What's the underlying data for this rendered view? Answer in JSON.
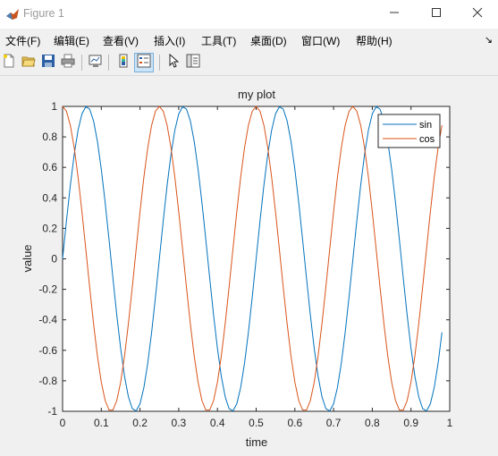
{
  "window": {
    "title": "Figure 1",
    "minimize_icon": "minimize-icon",
    "maximize_icon": "maximize-icon",
    "close_icon": "close-icon"
  },
  "menu": {
    "items": [
      {
        "label": "文件(F)"
      },
      {
        "label": "编辑(E)"
      },
      {
        "label": "查看(V)"
      },
      {
        "label": "插入(I)"
      },
      {
        "label": "工具(T)"
      },
      {
        "label": "桌面(D)"
      },
      {
        "label": "窗口(W)"
      },
      {
        "label": "帮助(H)"
      }
    ],
    "overflow_icon": "dock-arrow-icon"
  },
  "toolbar": {
    "buttons": [
      {
        "icon": "new-figure-icon"
      },
      {
        "icon": "open-file-icon"
      },
      {
        "icon": "save-icon"
      },
      {
        "icon": "print-icon"
      },
      {
        "icon": "link-plot-icon"
      },
      {
        "icon": "insert-colorbar-icon"
      },
      {
        "icon": "insert-legend-icon",
        "active": true
      },
      {
        "icon": "edit-plot-arrow-icon"
      },
      {
        "icon": "property-inspector-icon"
      }
    ]
  },
  "colors": {
    "sin": "#0072bd",
    "cos": "#d95319",
    "axes_bg": "#ffffff",
    "figure_bg": "#f0f0f0"
  },
  "chart_data": {
    "type": "line",
    "title": "my plot",
    "xlabel": "time",
    "ylabel": "value",
    "xlim": [
      0,
      1
    ],
    "ylim": [
      -1,
      1
    ],
    "xticks": [
      "0",
      "0.1",
      "0.2",
      "0.3",
      "0.4",
      "0.5",
      "0.6",
      "0.7",
      "0.8",
      "0.9",
      "1"
    ],
    "yticks": [
      "1",
      "0.8",
      "0.6",
      "0.4",
      "0.2",
      "0",
      "-0.2",
      "-0.4",
      "-0.6",
      "-0.8",
      "-1"
    ],
    "grid": false,
    "legend_position": "top-right",
    "x": {
      "start": 0,
      "end": 0.98,
      "step": 0.01
    },
    "series": [
      {
        "name": "sin",
        "function": "sin(2*pi*4*t)"
      },
      {
        "name": "cos",
        "function": "cos(2*pi*4*t)"
      }
    ]
  }
}
